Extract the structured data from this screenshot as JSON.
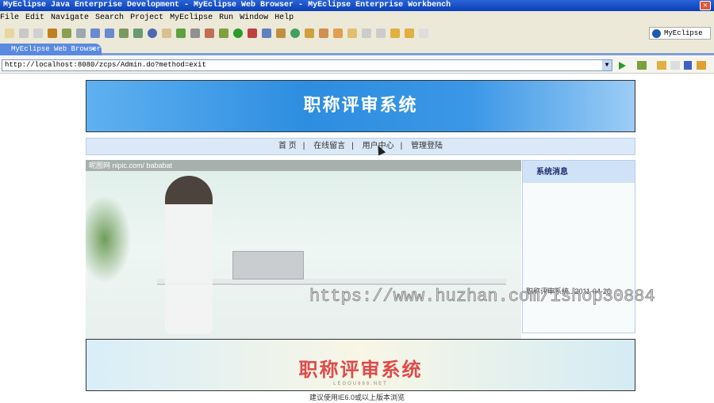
{
  "window": {
    "title": "MyEclipse Java Enterprise Development - MyEclipse Web Browser - MyEclipse Enterprise Workbench"
  },
  "menu": [
    "File",
    "Edit",
    "Navigate",
    "Search",
    "Project",
    "MyEclipse",
    "Run",
    "Window",
    "Help"
  ],
  "perspective": "MyEclipse ...",
  "tab": {
    "label": "MyEclipse Web Browser",
    "close": "✕"
  },
  "address": {
    "url": "http://localhost:8080/zcps/Admin.do?method=exit"
  },
  "page": {
    "banner_title": "职称评审系统",
    "nav": [
      "首 页",
      "在线留言",
      "用户中心",
      "管理登陆"
    ],
    "nav_sep": "|",
    "photo_caption": "昵图网 nipic.com/ bababat",
    "sidebar_title": "系统消息",
    "sidebar_message": "职称评审系统...2011-04-20",
    "footer_banner_title": "职称评审系统",
    "footer_banner_sub": "LEGOU888.NET",
    "footer_text": "建议使用IE6.0或以上版本浏览"
  },
  "watermark": "https://www.huzhan.com/ishop30884"
}
